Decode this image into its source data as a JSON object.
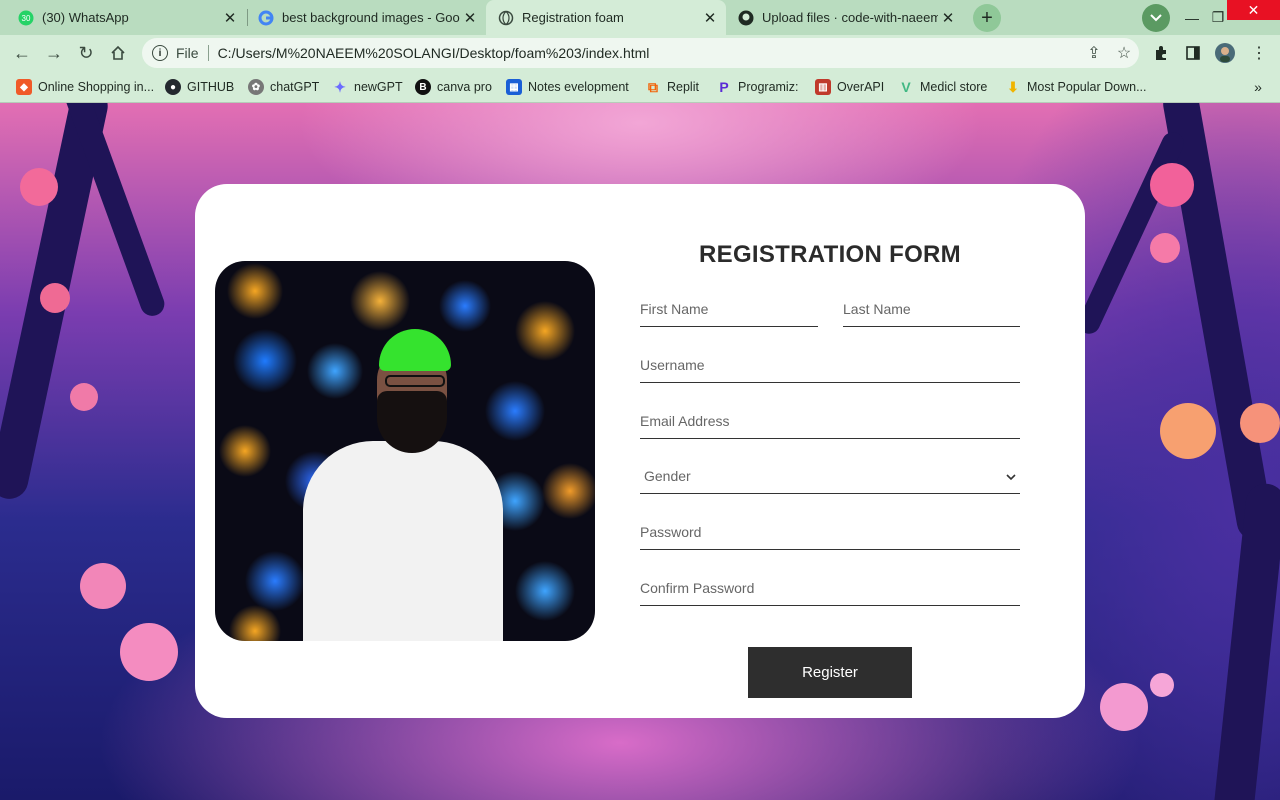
{
  "browser": {
    "tabs": [
      {
        "title": "(30) WhatsApp",
        "icon": "whatsapp-icon",
        "active": false
      },
      {
        "title": "best background images - Googl",
        "icon": "google-icon",
        "active": false
      },
      {
        "title": "Registration foam",
        "icon": "globe-icon",
        "active": true
      },
      {
        "title": "Upload files · code-with-naeem-s",
        "icon": "github-icon",
        "active": false
      }
    ],
    "address": {
      "scheme": "File",
      "url": "C:/Users/M%20NAEEM%20SOLANGI/Desktop/foam%203/index.html"
    },
    "bookmarks": [
      {
        "label": "Online Shopping in...",
        "icon": "shopping-icon",
        "color": "#f05a28"
      },
      {
        "label": "GITHUB",
        "icon": "github-icon",
        "color": "#24292f"
      },
      {
        "label": "chatGPT",
        "icon": "chatgpt-icon",
        "color": "#555555"
      },
      {
        "label": "newGPT",
        "icon": "sparkle-icon",
        "color": "#6b6bff"
      },
      {
        "label": "canva pro",
        "icon": "bolt-icon",
        "color": "#111111"
      },
      {
        "label": "Notes evelopment",
        "icon": "notes-icon",
        "color": "#1a5fd6"
      },
      {
        "label": "Replit",
        "icon": "replit-icon",
        "color": "#f26207"
      },
      {
        "label": "Programiz:",
        "icon": "programiz-icon",
        "color": "#5b2bd6"
      },
      {
        "label": "OverAPI",
        "icon": "overapi-icon",
        "color": "#c0392b"
      },
      {
        "label": "Medicl store",
        "icon": "vue-icon",
        "color": "#41b883"
      },
      {
        "label": "Most Popular Down...",
        "icon": "download-icon",
        "color": "#f0b400"
      }
    ]
  },
  "form": {
    "title": "REGISTRATION FORM",
    "first_name_placeholder": "First Name",
    "last_name_placeholder": "Last Name",
    "username_placeholder": "Username",
    "email_placeholder": "Email Address",
    "gender_selected": "Gender",
    "password_placeholder": "Password",
    "confirm_password_placeholder": "Confirm Password",
    "register_label": "Register"
  },
  "colors": {
    "tab_strip": "#b9dcbf",
    "toolbar": "#d4ecd7",
    "card": "#ffffff",
    "button": "#2e2e2e"
  }
}
